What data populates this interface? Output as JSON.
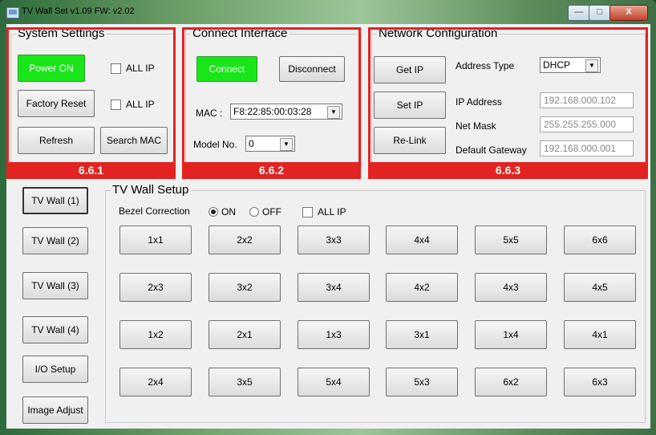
{
  "window": {
    "title": "TV Wall Set v1.09   FW: v2.02",
    "min_glyph": "—",
    "max_glyph": "□",
    "close_glyph": "X"
  },
  "system_settings": {
    "title": "System Settings",
    "power_on": "Power ON",
    "factory_reset": "Factory Reset",
    "refresh": "Refresh",
    "search_mac": "Search MAC",
    "all_ip_1": "ALL IP",
    "all_ip_2": "ALL IP",
    "tag": "6.6.1"
  },
  "connect_interface": {
    "title": "Connect Interface",
    "connect": "Connect",
    "disconnect": "Disconnect",
    "mac_label": "MAC :",
    "mac_value": "F8:22:85:00:03:28",
    "model_label": "Model No.",
    "model_value": "0",
    "tag": "6.6.2"
  },
  "network_configuration": {
    "title": "Network Configuration",
    "get_ip": "Get IP",
    "set_ip": "Set IP",
    "re_link": "Re-Link",
    "address_type_label": "Address Type",
    "address_type_value": "DHCP",
    "ip_label": "IP Address",
    "ip_value": "192.168.000.102",
    "mask_label": "Net Mask",
    "mask_value": "255.255.255.000",
    "gateway_label": "Default Gateway",
    "gateway_value": "192.168.000.001",
    "tag": "6.6.3"
  },
  "left_nav": [
    "TV Wall (1)",
    "TV Wall (2)",
    "TV Wall (3)",
    "TV Wall (4)",
    "I/O Setup",
    "Image Adjust"
  ],
  "tv_wall_setup": {
    "title": "TV Wall Setup",
    "bezel_label": "Bezel Correction",
    "on": "ON",
    "off": "OFF",
    "all_ip": "ALL IP",
    "grid": [
      [
        "1x1",
        "2x2",
        "3x3",
        "4x4",
        "5x5",
        "6x6"
      ],
      [
        "2x3",
        "3x2",
        "3x4",
        "4x2",
        "4x3",
        "4x5"
      ],
      [
        "1x2",
        "2x1",
        "1x3",
        "3x1",
        "1x4",
        "4x1"
      ],
      [
        "2x4",
        "3x5",
        "5x4",
        "5x3",
        "6x2",
        "6x3"
      ]
    ]
  }
}
